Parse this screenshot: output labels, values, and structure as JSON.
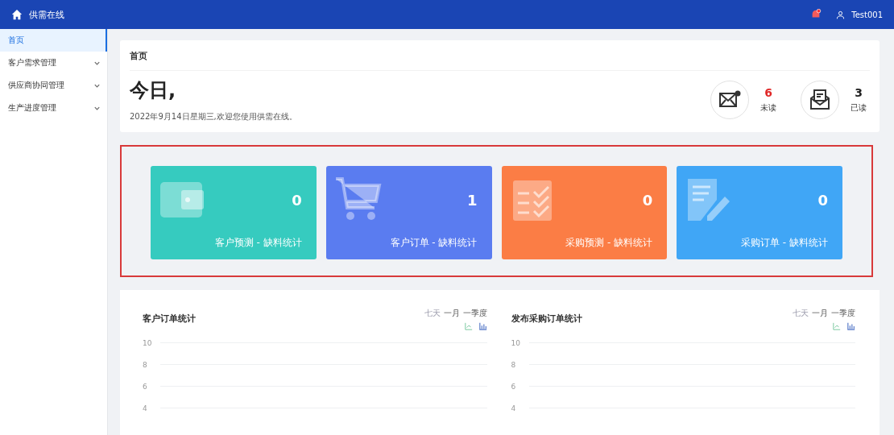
{
  "header": {
    "brand": "供需在线",
    "user": "Test001",
    "notification": true
  },
  "sidebar": {
    "items": [
      {
        "label": "首页",
        "selected": true,
        "expandable": false
      },
      {
        "label": "客户需求管理",
        "selected": false,
        "expandable": true
      },
      {
        "label": "供应商协同管理",
        "selected": false,
        "expandable": true
      },
      {
        "label": "生产进度管理",
        "selected": false,
        "expandable": true
      }
    ]
  },
  "welcome": {
    "breadcrumb": "首页",
    "greeting": "今日,",
    "date_line": "2022年9月14日星期三,欢迎您使用供需在线。",
    "messages": [
      {
        "kind": "unread",
        "count": "6",
        "label": "未读"
      },
      {
        "kind": "read",
        "count": "3",
        "label": "已读"
      }
    ]
  },
  "stats": {
    "highlighted": true,
    "cards": [
      {
        "kind": "wallet",
        "value": "0",
        "label": "客户预测 - 缺料统计",
        "color": "#36cbbf"
      },
      {
        "kind": "cart",
        "value": "1",
        "label": "客户订单 - 缺料统计",
        "color": "#5a7cf0"
      },
      {
        "kind": "calendar",
        "value": "0",
        "label": "采购预测 - 缺料统计",
        "color": "#fb7d45"
      },
      {
        "kind": "note",
        "value": "0",
        "label": "采购订单 - 缺料统计",
        "color": "#40a6f6"
      }
    ]
  },
  "charts": [
    {
      "title": "客户订单统计",
      "ranges": [
        {
          "label": "七天",
          "selected": true
        },
        {
          "label": "一月",
          "selected": false
        },
        {
          "label": "一季度",
          "selected": false
        }
      ],
      "y_labels": [
        "10",
        "8",
        "6",
        "4"
      ]
    },
    {
      "title": "发布采购订单统计",
      "ranges": [
        {
          "label": "七天",
          "selected": true
        },
        {
          "label": "一月",
          "selected": false
        },
        {
          "label": "一季度",
          "selected": false
        }
      ],
      "y_labels": [
        "10",
        "8",
        "6",
        "4"
      ]
    }
  ]
}
